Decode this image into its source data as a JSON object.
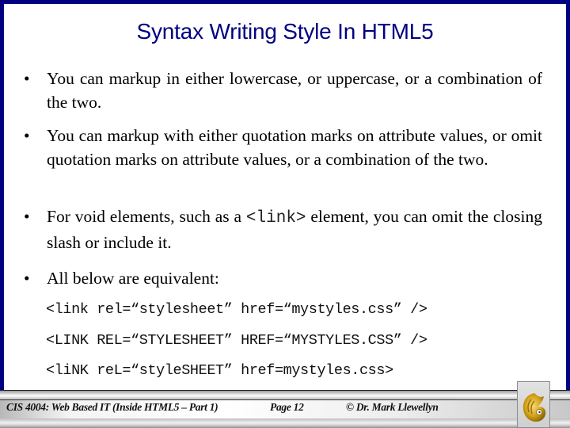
{
  "slide": {
    "title": "Syntax Writing Style In HTML5",
    "bullets": [
      {
        "symbol": "•",
        "text": "You can markup in either lowercase, or uppercase, or a combination of the two."
      },
      {
        "symbol": "•",
        "text": "You can markup with either quotation marks on attribute values, or omit quotation marks on attribute values, or a combination of the two."
      },
      {
        "symbol": "•",
        "text_before": "For void elements, such as a ",
        "code": "<link>",
        "text_after": "  element, you can omit the closing slash or include it."
      },
      {
        "symbol": "•",
        "text": "All below are equivalent:"
      }
    ],
    "code_lines": [
      "<link rel=“stylesheet” href=“mystyles.css” />",
      "<LINK REL=“STYLESHEET” HREF=“MYSTYLES.CSS” />",
      "<liNK reL=“styleSHEET” href=mystyles.css>"
    ]
  },
  "footer": {
    "course": "CIS 4004: Web Based IT (Inside HTML5 – Part 1)",
    "page": "Page 12",
    "copyright": "© Dr. Mark Llewellyn",
    "logo_icon": "pegasus-logo-icon"
  },
  "colors": {
    "border": "#000080",
    "title": "#000080",
    "logo_gold": "#d4a017"
  }
}
